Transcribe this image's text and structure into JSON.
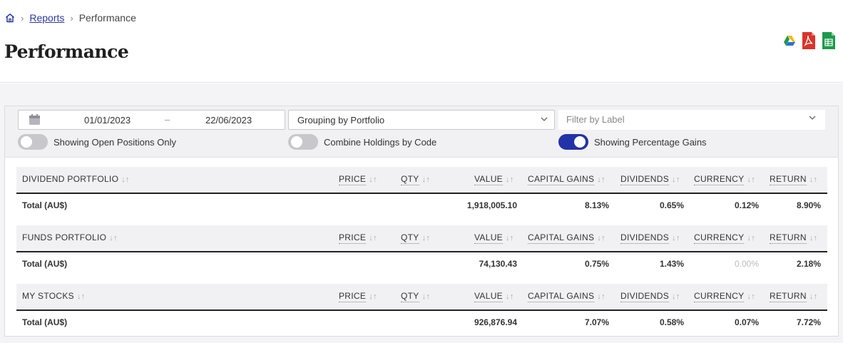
{
  "breadcrumb": {
    "home_icon": "home-icon",
    "reports": "Reports",
    "current": "Performance"
  },
  "page": {
    "title": "Performance"
  },
  "exports": [
    {
      "name": "google-drive-icon"
    },
    {
      "name": "pdf-icon"
    },
    {
      "name": "spreadsheet-icon"
    }
  ],
  "filters": {
    "date_from": "01/01/2023",
    "date_separator": "–",
    "date_to": "22/06/2023",
    "grouping": "Grouping by Portfolio",
    "label_placeholder": "Filter by Label",
    "toggles": {
      "open_positions": {
        "label": "Showing Open Positions Only",
        "on": false
      },
      "combine_holdings": {
        "label": "Combine Holdings by Code",
        "on": false
      },
      "percentage_gains": {
        "label": "Showing Percentage Gains",
        "on": true
      }
    }
  },
  "columns": {
    "price": "PRICE",
    "qty": "QTY",
    "value": "VALUE",
    "capital_gains": "CAPITAL GAINS",
    "dividends": "DIVIDENDS",
    "currency": "CURRENCY",
    "return": "RETURN",
    "sort_glyph": "↓↑"
  },
  "portfolios": [
    {
      "name": "DIVIDEND PORTFOLIO",
      "total_label": "Total (AU$)",
      "value": "1,918,005.10",
      "capital_gains": "8.13%",
      "dividends": "0.65%",
      "currency": "0.12%",
      "return": "8.90%"
    },
    {
      "name": "FUNDS PORTFOLIO",
      "total_label": "Total (AU$)",
      "value": "74,130.43",
      "capital_gains": "0.75%",
      "dividends": "1.43%",
      "currency": "0.00%",
      "return": "2.18%"
    },
    {
      "name": "MY STOCKS",
      "total_label": "Total (AU$)",
      "value": "926,876.94",
      "capital_gains": "7.07%",
      "dividends": "0.58%",
      "currency": "0.07%",
      "return": "7.72%"
    }
  ],
  "colors": {
    "accent": "#2233a8",
    "link": "#2a3aa0",
    "pdf": "#d9342b",
    "sheet": "#1e9a4b"
  }
}
